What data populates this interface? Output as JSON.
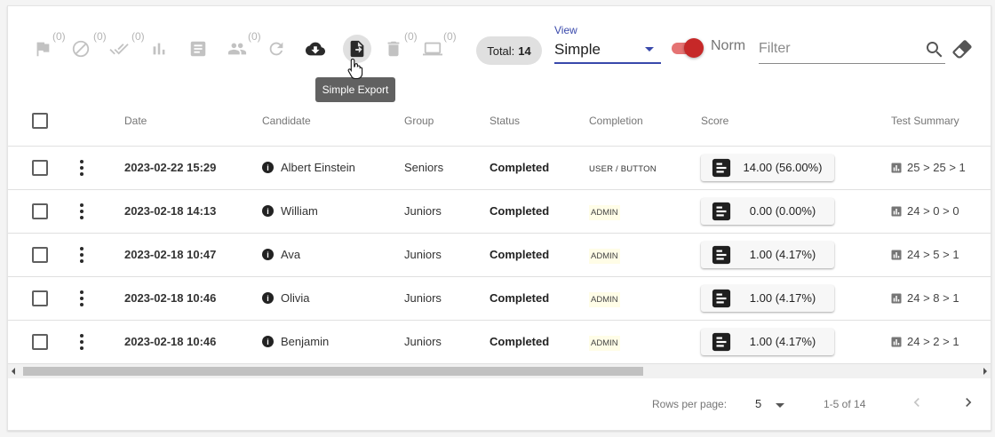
{
  "toolbar": {
    "counts": {
      "flag": "(0)",
      "block": "(0)",
      "done_all": "(0)",
      "people": "(0)",
      "delete": "(0)",
      "monitor": "(0)"
    },
    "tooltip": "Simple Export",
    "total_label": "Total:",
    "total_value": "14",
    "view_label": "View",
    "view_value": "Simple",
    "norm_label": "Norm",
    "norm_on": true,
    "filter_placeholder": "Filter"
  },
  "table": {
    "columns": [
      "Date",
      "Candidate",
      "Group",
      "Status",
      "Completion",
      "Score",
      "Test Summary"
    ],
    "rows": [
      {
        "date": "2023-02-22 15:29",
        "candidate": "Albert Einstein",
        "group": "Seniors",
        "status": "Completed",
        "completion": "USER / BUTTON",
        "completion_type": "text",
        "score": "14.00 (56.00%)",
        "summary": [
          "25",
          ">",
          "25",
          ">",
          "1"
        ]
      },
      {
        "date": "2023-02-18 14:13",
        "candidate": "William",
        "group": "Juniors",
        "status": "Completed",
        "completion": "ADMIN",
        "completion_type": "badge",
        "score": "0.00 (0.00%)",
        "summary": [
          "24",
          ">",
          "0",
          ">",
          "0"
        ]
      },
      {
        "date": "2023-02-18 10:47",
        "candidate": "Ava",
        "group": "Juniors",
        "status": "Completed",
        "completion": "ADMIN",
        "completion_type": "badge",
        "score": "1.00 (4.17%)",
        "summary": [
          "24",
          ">",
          "5",
          ">",
          "1"
        ]
      },
      {
        "date": "2023-02-18 10:46",
        "candidate": "Olivia",
        "group": "Juniors",
        "status": "Completed",
        "completion": "ADMIN",
        "completion_type": "badge",
        "score": "1.00 (4.17%)",
        "summary": [
          "24",
          ">",
          "8",
          ">",
          "1"
        ]
      },
      {
        "date": "2023-02-18 10:46",
        "candidate": "Benjamin",
        "group": "Juniors",
        "status": "Completed",
        "completion": "ADMIN",
        "completion_type": "badge",
        "score": "1.00 (4.17%)",
        "summary": [
          "24",
          ">",
          "2",
          ">",
          "1"
        ]
      }
    ]
  },
  "pagination": {
    "rows_per_page_label": "Rows per page:",
    "rows_per_page_value": "5",
    "range": "1-5 of 14"
  },
  "colors": {
    "accent": "#3949ab",
    "toggle": "#c62828",
    "admin_badge_bg": "#fffde7"
  }
}
